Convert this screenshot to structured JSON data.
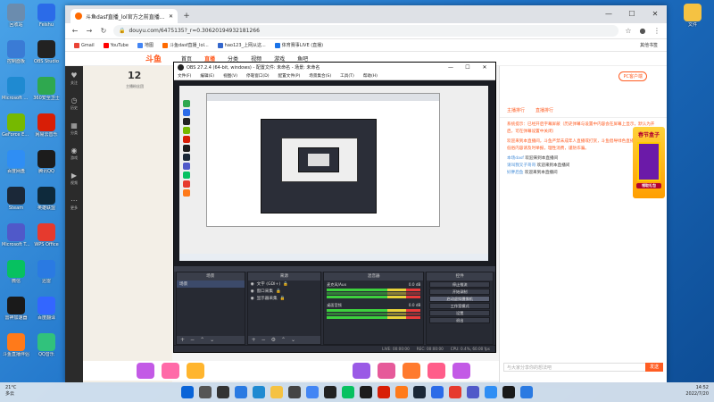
{
  "desktop": {
    "left_icons": [
      {
        "label": "回收站",
        "icon": "recycle-bin-icon",
        "color": "#6b8cae"
      },
      {
        "label": "Feishu",
        "icon": "feishu-icon",
        "color": "#2b6be8"
      },
      {
        "label": "控制面板",
        "icon": "control-panel-icon",
        "color": "#3a7bd5"
      },
      {
        "label": "OBS Studio",
        "icon": "obs-icon",
        "color": "#222222"
      },
      {
        "label": "Microsoft Edge",
        "icon": "edge-icon",
        "color": "#1f8ad1"
      },
      {
        "label": "360安全卫士",
        "icon": "360-icon",
        "color": "#2fa84f"
      },
      {
        "label": "GeForce Experience",
        "icon": "nvidia-icon",
        "color": "#76b900"
      },
      {
        "label": "网易云音乐",
        "icon": "netease-music-icon",
        "color": "#d81e06"
      },
      {
        "label": "百度网盘",
        "icon": "baidu-netdisk-icon",
        "color": "#2f8ef4"
      },
      {
        "label": "腾讯QQ",
        "icon": "qq-icon",
        "color": "#1c1c1c"
      },
      {
        "label": "Steam",
        "icon": "steam-icon",
        "color": "#1b2838"
      },
      {
        "label": "英雄联盟",
        "icon": "lol-icon",
        "color": "#0e2a3c"
      },
      {
        "label": "Microsoft Teams",
        "icon": "teams-icon",
        "color": "#5059c9"
      },
      {
        "label": "WPS Office",
        "icon": "wps-icon",
        "color": "#e63a2e"
      },
      {
        "label": "微信",
        "icon": "wechat-icon",
        "color": "#07c160"
      },
      {
        "label": "迅雷",
        "icon": "xunlei-icon",
        "color": "#2a7ae2"
      },
      {
        "label": "雷神加速器",
        "icon": "leishen-icon",
        "color": "#1a1a1a"
      },
      {
        "label": "百度翻译",
        "icon": "baidu-translate-icon",
        "color": "#3366ff"
      },
      {
        "label": "斗鱼直播伴侣",
        "icon": "douyu-companion-icon",
        "color": "#ff7a1a"
      },
      {
        "label": "QQ音乐",
        "icon": "qq-music-icon",
        "color": "#31c27c"
      }
    ],
    "right_icons": [
      {
        "label": "文件",
        "icon": "folder-icon",
        "color": "#f5c242"
      }
    ]
  },
  "browser": {
    "tab_title": "斗鱼dasf直播_lol官方之前直播...",
    "new_tab": "+",
    "url": "douyu.com/6475135?_r=0.30620194932181266",
    "bookmarks": [
      "Gmail",
      "YouTube",
      "地图",
      "斗鱼dasf直播_lol...",
      "hao123_上网从这...",
      "体育赛事LIVE (直播)"
    ],
    "side_label": "其他书签"
  },
  "site": {
    "logo": "斗鱼",
    "nav": [
      "首页",
      "直播",
      "分类",
      "视频",
      "游戏",
      "鱼吧"
    ],
    "active_nav": "直播",
    "sidebar": [
      {
        "label": "关注",
        "icon": "heart-icon"
      },
      {
        "label": "历史",
        "icon": "clock-icon"
      },
      {
        "label": "分类",
        "icon": "grid-icon"
      },
      {
        "label": "游戏",
        "icon": "gamepad-icon"
      },
      {
        "label": "视频",
        "icon": "video-icon"
      },
      {
        "label": "更多",
        "icon": "more-icon"
      }
    ],
    "fans_count": "12",
    "fans_label": "主播粉丝团",
    "pc_client": "PC客户端",
    "chat_tabs": [
      "主播排行",
      "直播排行"
    ],
    "chat_system": [
      "系统提示：已经开启字幕屏蔽（历史弹幕与设置中内容会在屏幕上显示，默认为开启，可在弹幕设置中关闭）",
      "欢迎来到本直播间，斗鱼严禁未成年人直播或打赏，斗鱼倡导绿色直播，如有违规或低俗内容请及时举报，理性消费，谨防诈骗。"
    ],
    "chat_msgs": [
      {
        "user": "本场dasf",
        "text": "欢迎来到本直播间"
      },
      {
        "user": "请叫我叉子哥哥",
        "text": "欢迎来到本直播间"
      },
      {
        "user": "好胖后鱼",
        "text": "欢迎来到本直播间"
      }
    ],
    "chat_placeholder": "与大家分享你的想法吧",
    "send_label": "发送",
    "promo_title": "春节盒子",
    "promo_sub": "领取礼包"
  },
  "obs": {
    "title": "OBS 27.2.4 (64-bit, windows) - 配置文件: 未命名 - 场景: 未命名",
    "menu": [
      "文件(F)",
      "编辑(E)",
      "视图(V)",
      "停靠窗口(D)",
      "配置文件(P)",
      "场景集合(S)",
      "工具(T)",
      "帮助(H)"
    ],
    "docks": {
      "scenes": {
        "header": "场景",
        "items": [
          "场景"
        ]
      },
      "sources": {
        "header": "来源",
        "items": [
          "文字 (GDI+)",
          "窗口采集",
          "显示器采集"
        ]
      },
      "mixer": {
        "header": "混音器",
        "channels": [
          {
            "name": "麦克风/Aux",
            "db": "0.0 dB"
          },
          {
            "name": "桌面音频",
            "db": "0.0 dB"
          }
        ]
      },
      "controls": {
        "header": "控件",
        "buttons": [
          "停止推流",
          "开始录制",
          "启动虚拟摄像机",
          "工作室模式",
          "设置",
          "退出"
        ],
        "hover_index": 2
      }
    },
    "status": {
      "live": "LIVE: 00:00:00",
      "rec": "REC: 00:00:00",
      "cpu": "CPU: 0.4%, 60.00 fps"
    }
  },
  "taskbar": {
    "weather_temp": "21°C",
    "weather_text": "多云",
    "time": "14:52",
    "date": "2022/7/20",
    "apps": [
      "start-icon",
      "search-icon",
      "taskview-icon",
      "widgets-icon",
      "edge-icon",
      "explorer-icon",
      "store-icon",
      "chrome-icon",
      "obs-icon",
      "wechat-icon",
      "qq-icon",
      "netease-music-icon",
      "douyu-icon",
      "steam-icon",
      "feishu-icon",
      "wps-icon",
      "teams-icon",
      "baidu-netdisk-icon",
      "leishen-icon",
      "xunlei-icon"
    ]
  }
}
